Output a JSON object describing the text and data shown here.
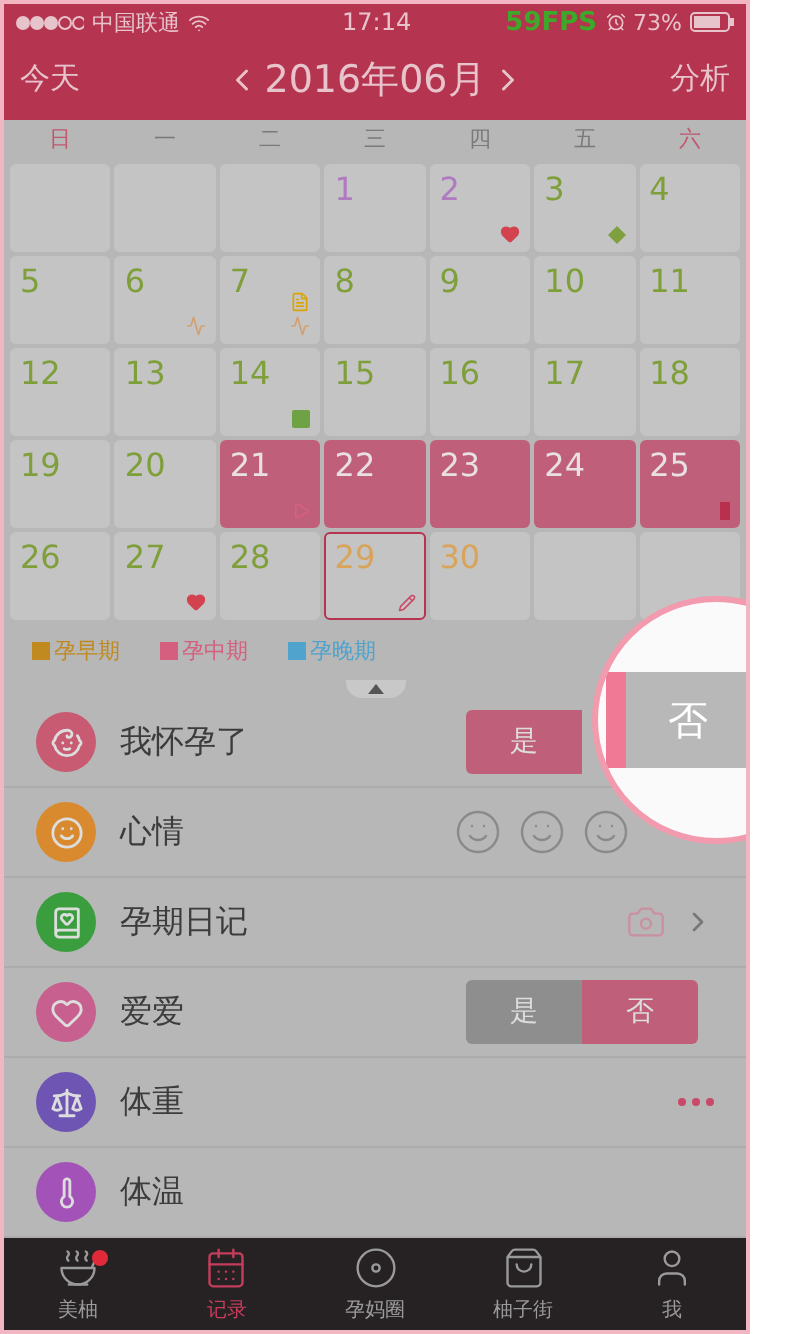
{
  "status_bar": {
    "carrier": "中国联通",
    "time": "17:14",
    "fps": "59FPS",
    "battery": "73%"
  },
  "header": {
    "left": "今天",
    "title": "2016年06月",
    "right": "分析"
  },
  "weekdays": [
    {
      "label": "日",
      "kind": "weekend"
    },
    {
      "label": "一",
      "kind": "weekday"
    },
    {
      "label": "二",
      "kind": "weekday"
    },
    {
      "label": "三",
      "kind": "weekday"
    },
    {
      "label": "四",
      "kind": "weekday"
    },
    {
      "label": "五",
      "kind": "weekday"
    },
    {
      "label": "六",
      "kind": "weekend"
    }
  ],
  "weeks": [
    [
      {
        "kind": "blank"
      },
      {
        "kind": "blank"
      },
      {
        "kind": "blank"
      },
      {
        "kind": "day",
        "day": "1",
        "color": "#b07ac0",
        "highlighted": false,
        "selected": false
      },
      {
        "kind": "day",
        "day": "2",
        "color": "#b07ac0",
        "highlighted": false,
        "selected": false,
        "icons": [
          {
            "kind": "heart"
          }
        ]
      },
      {
        "kind": "day",
        "day": "3",
        "color": "#7f9f3a",
        "highlighted": false,
        "selected": false,
        "icons": [
          {
            "kind": "diamond"
          }
        ]
      },
      {
        "kind": "day",
        "day": "4",
        "color": "#7f9f3a",
        "highlighted": false,
        "selected": false
      }
    ],
    [
      {
        "kind": "day",
        "day": "5",
        "color": "#7f9f3a",
        "highlighted": false,
        "selected": false
      },
      {
        "kind": "day",
        "day": "6",
        "color": "#7f9f3a",
        "highlighted": false,
        "selected": false,
        "icons": [
          {
            "kind": "chart"
          }
        ]
      },
      {
        "kind": "day",
        "day": "7",
        "color": "#7f9f3a",
        "highlighted": false,
        "selected": false,
        "icons": [
          {
            "kind": "note"
          },
          {
            "kind": "chart"
          }
        ]
      },
      {
        "kind": "day",
        "day": "8",
        "color": "#7f9f3a",
        "highlighted": false,
        "selected": false
      },
      {
        "kind": "day",
        "day": "9",
        "color": "#7f9f3a",
        "highlighted": false,
        "selected": false
      },
      {
        "kind": "day",
        "day": "10",
        "color": "#7f9f3a",
        "highlighted": false,
        "selected": false
      },
      {
        "kind": "day",
        "day": "11",
        "color": "#7f9f3a",
        "highlighted": false,
        "selected": false
      }
    ],
    [
      {
        "kind": "day",
        "day": "12",
        "color": "#7f9f3a",
        "highlighted": false,
        "selected": false
      },
      {
        "kind": "day",
        "day": "13",
        "color": "#7f9f3a",
        "highlighted": false,
        "selected": false
      },
      {
        "kind": "day",
        "day": "14",
        "color": "#7f9f3a",
        "highlighted": false,
        "selected": false,
        "icons": [
          {
            "kind": "square"
          }
        ]
      },
      {
        "kind": "day",
        "day": "15",
        "color": "#7f9f3a",
        "highlighted": false,
        "selected": false
      },
      {
        "kind": "day",
        "day": "16",
        "color": "#7f9f3a",
        "highlighted": false,
        "selected": false
      },
      {
        "kind": "day",
        "day": "17",
        "color": "#7f9f3a",
        "highlighted": false,
        "selected": false
      },
      {
        "kind": "day",
        "day": "18",
        "color": "#7f9f3a",
        "highlighted": false,
        "selected": false
      }
    ],
    [
      {
        "kind": "day",
        "day": "19",
        "color": "#7f9f3a",
        "highlighted": false,
        "selected": false
      },
      {
        "kind": "day",
        "day": "20",
        "color": "#7f9f3a",
        "highlighted": false,
        "selected": false
      },
      {
        "kind": "day",
        "day": "21",
        "color": "#e8e0e2",
        "highlighted": true,
        "selected": false,
        "icons": [
          {
            "kind": "play"
          }
        ]
      },
      {
        "kind": "day",
        "day": "22",
        "color": "#e8e0e2",
        "highlighted": true,
        "selected": false
      },
      {
        "kind": "day",
        "day": "23",
        "color": "#e8e0e2",
        "highlighted": true,
        "selected": false
      },
      {
        "kind": "day",
        "day": "24",
        "color": "#e8e0e2",
        "highlighted": true,
        "selected": false
      },
      {
        "kind": "day",
        "day": "25",
        "color": "#e8e0e2",
        "highlighted": true,
        "selected": false,
        "icons": [
          {
            "kind": "bar"
          }
        ]
      }
    ],
    [
      {
        "kind": "day",
        "day": "26",
        "color": "#7f9f3a",
        "highlighted": false,
        "selected": false
      },
      {
        "kind": "day",
        "day": "27",
        "color": "#7f9f3a",
        "highlighted": false,
        "selected": false,
        "icons": [
          {
            "kind": "heart"
          }
        ]
      },
      {
        "kind": "day",
        "day": "28",
        "color": "#7f9f3a",
        "highlighted": false,
        "selected": false
      },
      {
        "kind": "day",
        "day": "29",
        "color": "#d9a45a",
        "highlighted": false,
        "selected": true,
        "icons": [
          {
            "kind": "pencil"
          }
        ]
      },
      {
        "kind": "day",
        "day": "30",
        "color": "#d9a45a",
        "highlighted": false,
        "selected": false
      },
      {
        "kind": "blank"
      },
      {
        "kind": "blank"
      }
    ]
  ],
  "legend": [
    {
      "label": "孕早期",
      "color": "#c08a20"
    },
    {
      "label": "孕中期",
      "color": "#d45f7e"
    },
    {
      "label": "孕晚期",
      "color": "#4fa3cc"
    }
  ],
  "records": [
    {
      "label": "我怀孕了",
      "kind": "toggle",
      "color": "#c85a72",
      "options": [
        {
          "label": "是",
          "selected": true
        }
      ]
    },
    {
      "label": "心情",
      "kind": "moods",
      "color": "#d98a2e"
    },
    {
      "label": "孕期日记",
      "kind": "camera",
      "color": "#3a9e3f"
    },
    {
      "label": "爱爱",
      "kind": "toggle",
      "color": "#c8608f",
      "options": [
        {
          "label": "是",
          "selected": false
        },
        {
          "label": "否",
          "selected": true
        }
      ]
    },
    {
      "label": "体重",
      "kind": "more",
      "color": "#6f55b3"
    },
    {
      "label": "体温",
      "kind": "plain",
      "color": "#a353b8"
    }
  ],
  "magnifier": {
    "label": "否",
    "selected": false
  },
  "tabs": [
    {
      "label": "美柚",
      "selected": false,
      "badge": true
    },
    {
      "label": "记录",
      "selected": true,
      "badge": false
    },
    {
      "label": "孕妈圈",
      "selected": false,
      "badge": false
    },
    {
      "label": "柚子街",
      "selected": false,
      "badge": false
    },
    {
      "label": "我",
      "selected": false,
      "badge": false
    }
  ]
}
